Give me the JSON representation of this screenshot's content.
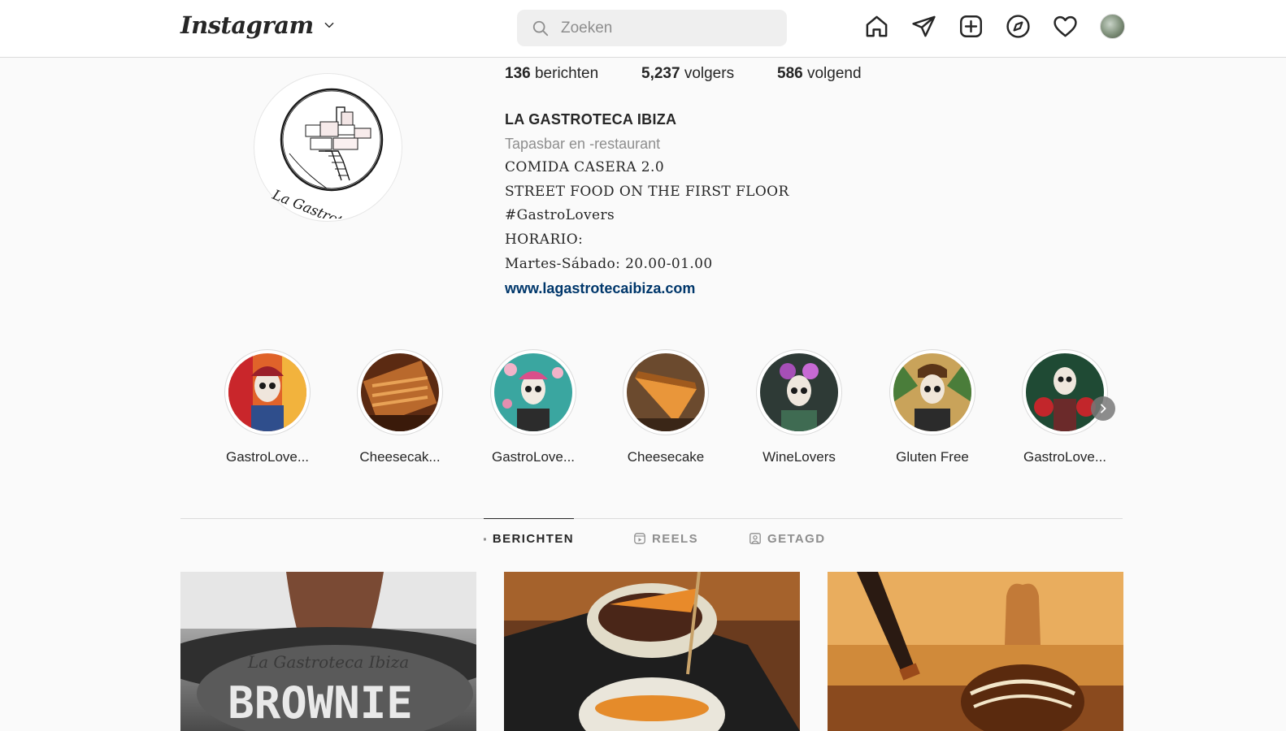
{
  "nav": {
    "logo": "Instagram",
    "search_placeholder": "Zoeken",
    "icons": [
      "home-icon",
      "direct-icon",
      "new-post-icon",
      "explore-icon",
      "activity-icon",
      "avatar"
    ]
  },
  "profile": {
    "stats": {
      "posts_count": "136",
      "posts_label": " berichten",
      "followers_count": "5,237",
      "followers_label": " volgers",
      "following_count": "586",
      "following_label": " volgend"
    },
    "name": "LA GASTROTECA IBIZA",
    "category": "Tapasbar en -restaurant",
    "bio_lines": [
      "COMIDA CASERA 2.0",
      "STREET FOOD ON THE FIRST FLOOR",
      "#GastroLovers",
      "HORARIO:",
      "Martes-Sábado: 20.00-01.00"
    ],
    "website": "www.lagastrotecaibiza.com",
    "logo_caption": "La Gastroteca Ibiza"
  },
  "highlights": [
    {
      "label": "GastroLove...",
      "theme": "catrina-orange"
    },
    {
      "label": "Cheesecak...",
      "theme": "cheesecake-caramel"
    },
    {
      "label": "GastroLove...",
      "theme": "catrina-teal"
    },
    {
      "label": "Cheesecake",
      "theme": "cheesecake-slice"
    },
    {
      "label": "WineLovers",
      "theme": "catrina-purple"
    },
    {
      "label": "Gluten Free",
      "theme": "catrina-leaves"
    },
    {
      "label": "GastroLove...",
      "theme": "catrina-boxer"
    }
  ],
  "tabs": [
    {
      "label": "BERICHTEN",
      "icon": "grid-icon",
      "active": true
    },
    {
      "label": "REELS",
      "icon": "reels-icon",
      "active": false
    },
    {
      "label": "GETAGD",
      "icon": "tagged-icon",
      "active": false
    }
  ],
  "posts": [
    {
      "overlay_script": "La Gastroteca Ibiza",
      "overlay_title": "BROWNIE"
    },
    {
      "overlay_script": "",
      "overlay_title": ""
    },
    {
      "overlay_script": "",
      "overlay_title": ""
    }
  ],
  "colors": {
    "accent_link": "#00376b",
    "border": "#dbdbdb",
    "muted": "#8e8e8e"
  }
}
